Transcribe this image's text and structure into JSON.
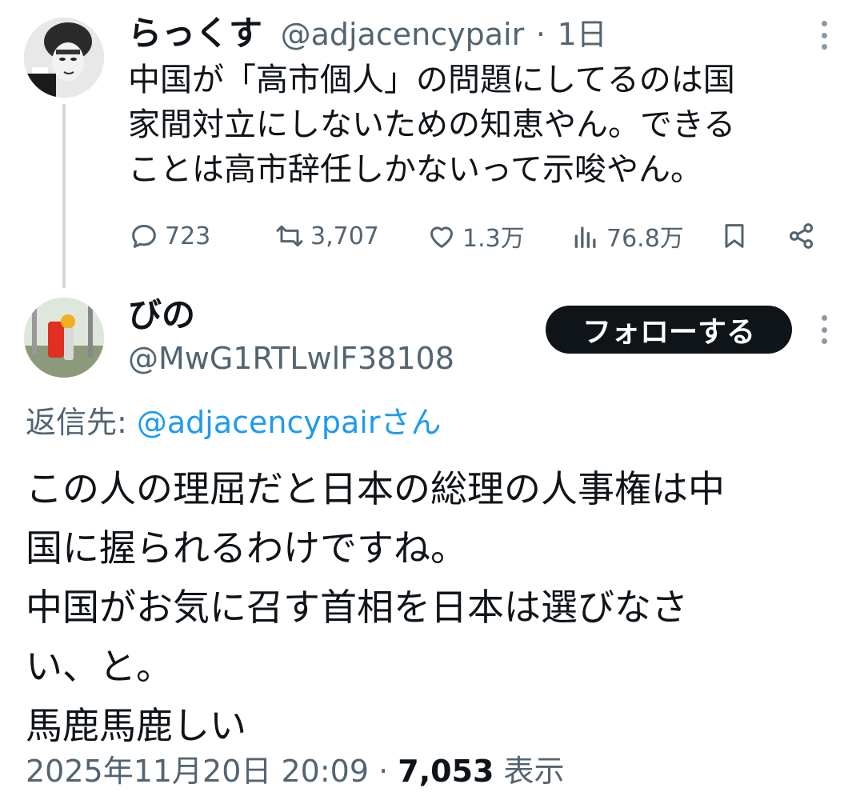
{
  "tweet1": {
    "display_name": "らっくす",
    "handle": "@adjacencypair",
    "separator": "·",
    "time": "1日",
    "text": "中国が「高市個人」の問題にしてるのは国\n家間対立にしないための知恵やん。できる\nことは高市辞任しかないって示唆やん。",
    "replies": "723",
    "retweets": "3,707",
    "likes": "1.3万",
    "views": "76.8万"
  },
  "tweet2": {
    "display_name": "びの",
    "handle": "@MwG1RTLwlF38108",
    "follow_label": "フォローする",
    "replying_prefix": "返信先: ",
    "replying_to": "@adjacencypairさん",
    "text": "この人の理屈だと日本の総理の人事権は中\n国に握られるわけですね。\n中国がお気に召す首相を日本は選びなさ\nい、と。\n馬鹿馬鹿しい",
    "timestamp": "2025年11月20日 20:09",
    "separator": " · ",
    "view_count": "7,053",
    "view_label": " 表示"
  },
  "colors": {
    "text": "#0f1419",
    "secondary": "#536471",
    "link": "#1d9bf0",
    "follow_button_bg": "#0f1419"
  },
  "icons": [
    "more-icon",
    "reply-icon",
    "retweet-icon",
    "like-icon",
    "views-icon",
    "bookmark-icon",
    "share-icon"
  ]
}
